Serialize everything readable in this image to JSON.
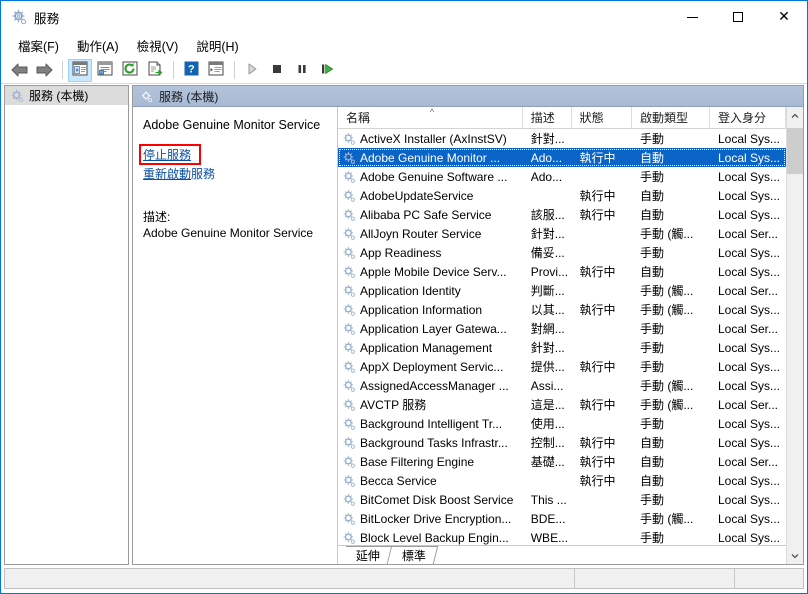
{
  "window": {
    "title": "服務",
    "icon": "services-gear-icon",
    "minimize_label": "最小化",
    "maximize_label": "最大化",
    "close_label": "關閉"
  },
  "menu": [
    {
      "label": "檔案(F)",
      "name": "menu-file"
    },
    {
      "label": "動作(A)",
      "name": "menu-action"
    },
    {
      "label": "檢視(V)",
      "name": "menu-view"
    },
    {
      "label": "說明(H)",
      "name": "menu-help"
    }
  ],
  "toolbar": [
    {
      "name": "back-arrow-icon",
      "kind": "back"
    },
    {
      "name": "forward-arrow-icon",
      "kind": "forward"
    },
    {
      "name": "separator-1",
      "kind": "sep"
    },
    {
      "name": "show-hide-tree-icon",
      "kind": "tree",
      "pressed": true
    },
    {
      "name": "properties-icon",
      "kind": "properties"
    },
    {
      "name": "refresh-icon",
      "kind": "refresh"
    },
    {
      "name": "export-list-icon",
      "kind": "export"
    },
    {
      "name": "separator-2",
      "kind": "sep"
    },
    {
      "name": "help-icon",
      "kind": "help"
    },
    {
      "name": "show-action-pane-icon",
      "kind": "actionpane"
    },
    {
      "name": "separator-3",
      "kind": "sep"
    },
    {
      "name": "start-service-icon",
      "kind": "play"
    },
    {
      "name": "stop-service-icon",
      "kind": "stop"
    },
    {
      "name": "pause-service-icon",
      "kind": "pause"
    },
    {
      "name": "restart-service-icon",
      "kind": "restart"
    }
  ],
  "tree": {
    "root_label": "服務 (本機)",
    "root_icon": "services-gear-icon"
  },
  "pane": {
    "header_label": "服務 (本機)",
    "header_icon": "services-gear-icon"
  },
  "details": {
    "service_name": "Adobe Genuine Monitor Service",
    "stop_link": "停止服務",
    "restart_link_underlined": "重新啟動",
    "restart_link_tail": "服務",
    "description_label": "描述:",
    "description_text": "Adobe Genuine Monitor Service",
    "annotation_color": "#ff0000"
  },
  "list": {
    "columns": [
      {
        "label": "名稱",
        "name": "column-name",
        "width": 190,
        "sorted": "asc",
        "sort_glyph": "^"
      },
      {
        "label": "描述",
        "name": "column-description",
        "width": 50
      },
      {
        "label": "狀態",
        "name": "column-status",
        "width": 62
      },
      {
        "label": "啟動類型",
        "name": "column-startup-type",
        "width": 80
      },
      {
        "label": "登入身分",
        "name": "column-logon-as",
        "width": 78
      }
    ],
    "rows": [
      {
        "name": "ActiveX Installer (AxInstSV)",
        "description": "針對...",
        "status": "",
        "startup": "手動",
        "logon": "Local Sys...",
        "selected": false
      },
      {
        "name": "Adobe Genuine Monitor ...",
        "description": "Ado...",
        "status": "執行中",
        "startup": "自動",
        "logon": "Local Sys...",
        "selected": true
      },
      {
        "name": "Adobe Genuine Software ...",
        "description": "Ado...",
        "status": "",
        "startup": "手動",
        "logon": "Local Sys...",
        "selected": false
      },
      {
        "name": "AdobeUpdateService",
        "description": "",
        "status": "執行中",
        "startup": "自動",
        "logon": "Local Sys...",
        "selected": false
      },
      {
        "name": "Alibaba PC Safe Service",
        "description": "該服...",
        "status": "執行中",
        "startup": "自動",
        "logon": "Local Sys...",
        "selected": false
      },
      {
        "name": "AllJoyn Router Service",
        "description": "針對...",
        "status": "",
        "startup": "手動 (觸...",
        "logon": "Local Ser...",
        "selected": false
      },
      {
        "name": "App Readiness",
        "description": "備妥...",
        "status": "",
        "startup": "手動",
        "logon": "Local Sys...",
        "selected": false
      },
      {
        "name": "Apple Mobile Device Serv...",
        "description": "Provi...",
        "status": "執行中",
        "startup": "自動",
        "logon": "Local Sys...",
        "selected": false
      },
      {
        "name": "Application Identity",
        "description": "判斷...",
        "status": "",
        "startup": "手動 (觸...",
        "logon": "Local Ser...",
        "selected": false
      },
      {
        "name": "Application Information",
        "description": "以其...",
        "status": "執行中",
        "startup": "手動 (觸...",
        "logon": "Local Sys...",
        "selected": false
      },
      {
        "name": "Application Layer Gatewa...",
        "description": "對網...",
        "status": "",
        "startup": "手動",
        "logon": "Local Ser...",
        "selected": false
      },
      {
        "name": "Application Management",
        "description": "針對...",
        "status": "",
        "startup": "手動",
        "logon": "Local Sys...",
        "selected": false
      },
      {
        "name": "AppX Deployment Servic...",
        "description": "提供...",
        "status": "執行中",
        "startup": "手動",
        "logon": "Local Sys...",
        "selected": false
      },
      {
        "name": "AssignedAccessManager ...",
        "description": "Assi...",
        "status": "",
        "startup": "手動 (觸...",
        "logon": "Local Sys...",
        "selected": false
      },
      {
        "name": "AVCTP 服務",
        "description": "這是...",
        "status": "執行中",
        "startup": "手動 (觸...",
        "logon": "Local Ser...",
        "selected": false
      },
      {
        "name": "Background Intelligent Tr...",
        "description": "使用...",
        "status": "",
        "startup": "手動",
        "logon": "Local Sys...",
        "selected": false
      },
      {
        "name": "Background Tasks Infrastr...",
        "description": "控制...",
        "status": "執行中",
        "startup": "自動",
        "logon": "Local Sys...",
        "selected": false
      },
      {
        "name": "Base Filtering Engine",
        "description": "基礎...",
        "status": "執行中",
        "startup": "自動",
        "logon": "Local Ser...",
        "selected": false
      },
      {
        "name": "Becca Service",
        "description": "",
        "status": "執行中",
        "startup": "自動",
        "logon": "Local Sys...",
        "selected": false
      },
      {
        "name": "BitComet Disk Boost Service",
        "description": "This ...",
        "status": "",
        "startup": "手動",
        "logon": "Local Sys...",
        "selected": false
      },
      {
        "name": "BitLocker Drive Encryption...",
        "description": "BDE...",
        "status": "",
        "startup": "手動 (觸...",
        "logon": "Local Sys...",
        "selected": false
      },
      {
        "name": "Block Level Backup Engin...",
        "description": "WBE...",
        "status": "",
        "startup": "手動",
        "logon": "Local Sys...",
        "selected": false
      }
    ],
    "scroll_up_glyph": "^",
    "scroll_down_glyph": "v"
  },
  "tabs": [
    {
      "label": "延伸",
      "name": "tab-extended",
      "active": false
    },
    {
      "label": "標準",
      "name": "tab-standard",
      "active": true
    }
  ],
  "statusbar": {
    "pane1": "",
    "pane2": "",
    "pane3": ""
  },
  "colors": {
    "selection_blue": "#0a64c8",
    "titlebar_border": "#0078d7",
    "pane_header": "#b0c0d8",
    "link": "#0b4ea2",
    "annotation_red": "#ff0000"
  }
}
